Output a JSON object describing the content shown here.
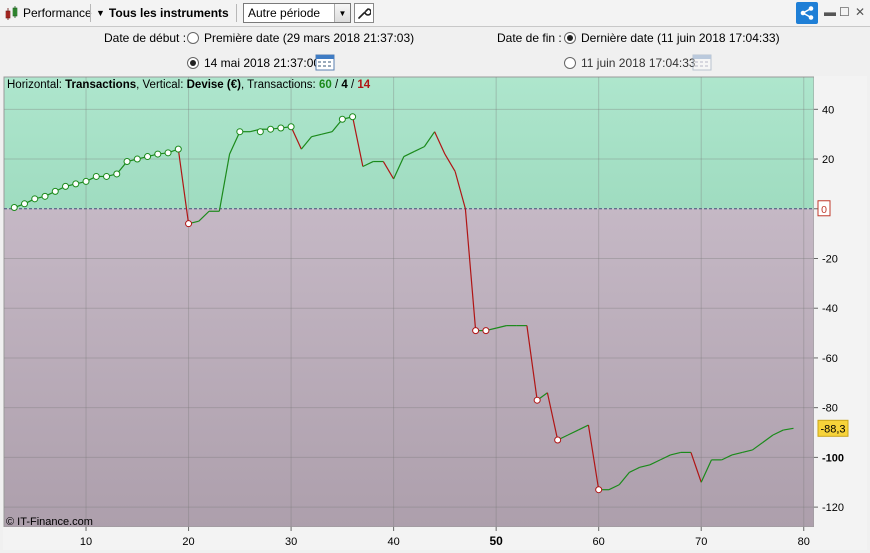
{
  "toolbar": {
    "performance_label": "Performance",
    "instruments_label": "Tous les instruments",
    "period_select_value": "Autre période"
  },
  "date_start": {
    "label": "Date de début :",
    "option1": "Première date (29 mars 2018 21:37:03)",
    "option2": "14 mai 2018 21:37:00",
    "selected": 2
  },
  "date_end": {
    "label": "Date de fin :",
    "option1": "Dernière date (11 juin 2018 17:04:33)",
    "option2": "11 juin 2018 17:04:33",
    "selected": 1
  },
  "chart_header": {
    "prefix": "Horizontal: ",
    "h_value": "Transactions",
    "mid": ", Vertical: ",
    "v_value": "Devise (€)",
    "trans_prefix": ", Transactions: ",
    "total": "60",
    "sep1": " / ",
    "wins": "4",
    "sep2": " / ",
    "losses": "14"
  },
  "watermark": "© IT-Finance.com",
  "colors": {
    "positive_zone": "#a9e3c9",
    "negative_zone": "#bcacb9",
    "up_line": "#1b8a1b",
    "down_line": "#b01515",
    "label_highlight": "#f7d33a",
    "share_button": "#1f7fd6"
  },
  "chart_data": {
    "type": "line",
    "xlim": [
      2,
      81
    ],
    "ylim": [
      -128,
      53
    ],
    "x_ticks": [
      10,
      20,
      30,
      40,
      50,
      60,
      70,
      80
    ],
    "x_tick_labels": [
      "10",
      "20",
      "30",
      "40",
      "50",
      "60",
      "70",
      "80"
    ],
    "y_ticks": [
      40,
      20,
      0,
      -20,
      -40,
      -60,
      -80,
      -100,
      -120
    ],
    "y_tick_labels": [
      "40",
      "20",
      "0",
      "-20",
      "-40",
      "-60",
      "-80",
      "-100",
      "-120"
    ],
    "zero_label": "0",
    "last_value_label": "-88,3",
    "points": [
      [
        3,
        0.5
      ],
      [
        4,
        2
      ],
      [
        5,
        4
      ],
      [
        6,
        5
      ],
      [
        7,
        7
      ],
      [
        8,
        9
      ],
      [
        9,
        10
      ],
      [
        10,
        11
      ],
      [
        11,
        13
      ],
      [
        12,
        13
      ],
      [
        13,
        14
      ],
      [
        14,
        19
      ],
      [
        15,
        20
      ],
      [
        16,
        21
      ],
      [
        17,
        22
      ],
      [
        18,
        22.5
      ],
      [
        19,
        24
      ],
      [
        20,
        -6
      ],
      [
        21,
        -5
      ],
      [
        22,
        -1
      ],
      [
        23,
        -1
      ],
      [
        24,
        22
      ],
      [
        25,
        31
      ],
      [
        26,
        31
      ],
      [
        27,
        32
      ],
      [
        28,
        32
      ],
      [
        29,
        32.5
      ],
      [
        30,
        33
      ],
      [
        31,
        24
      ],
      [
        32,
        29
      ],
      [
        33,
        30
      ],
      [
        34,
        31
      ],
      [
        35,
        36
      ],
      [
        36,
        37
      ],
      [
        37,
        17
      ],
      [
        38,
        19
      ],
      [
        39,
        19
      ],
      [
        40,
        12
      ],
      [
        41,
        21
      ],
      [
        42,
        23
      ],
      [
        43,
        25
      ],
      [
        44,
        31
      ],
      [
        45,
        22
      ],
      [
        46,
        15
      ],
      [
        47,
        0
      ],
      [
        48,
        -49
      ],
      [
        49,
        -49
      ],
      [
        50,
        -48
      ],
      [
        51,
        -47
      ],
      [
        52,
        -47
      ],
      [
        53,
        -47
      ],
      [
        54,
        -77
      ],
      [
        55,
        -74
      ],
      [
        56,
        -93
      ],
      [
        57,
        -91
      ],
      [
        58,
        -89
      ],
      [
        59,
        -87
      ],
      [
        60,
        -113
      ],
      [
        61,
        -113
      ],
      [
        62,
        -111
      ],
      [
        63,
        -106
      ],
      [
        64,
        -104
      ],
      [
        65,
        -103
      ],
      [
        66,
        -101
      ],
      [
        67,
        -99
      ],
      [
        68,
        -98
      ],
      [
        69,
        -98
      ],
      [
        70,
        -110
      ],
      [
        71,
        -101
      ],
      [
        72,
        -101
      ],
      [
        73,
        -99
      ],
      [
        74,
        -98
      ],
      [
        75,
        -97
      ],
      [
        76,
        -94
      ],
      [
        77,
        -91
      ],
      [
        78,
        -89
      ],
      [
        79,
        -88.3
      ]
    ],
    "markers": [
      [
        3,
        0.5
      ],
      [
        4,
        2
      ],
      [
        5,
        4
      ],
      [
        6,
        5
      ],
      [
        7,
        7
      ],
      [
        8,
        9
      ],
      [
        9,
        10
      ],
      [
        10,
        11
      ],
      [
        11,
        13
      ],
      [
        12,
        13
      ],
      [
        13,
        14
      ],
      [
        14,
        19
      ],
      [
        15,
        20
      ],
      [
        16,
        21
      ],
      [
        17,
        22
      ],
      [
        18,
        22.5
      ],
      [
        19,
        24
      ],
      [
        20,
        -6
      ],
      [
        25,
        31
      ],
      [
        27,
        31
      ],
      [
        28,
        32
      ],
      [
        29,
        32.5
      ],
      [
        30,
        33
      ],
      [
        35,
        36
      ],
      [
        36,
        37
      ],
      [
        48,
        -49
      ],
      [
        49,
        -49
      ],
      [
        54,
        -77
      ],
      [
        56,
        -93
      ],
      [
        60,
        -113
      ]
    ]
  }
}
